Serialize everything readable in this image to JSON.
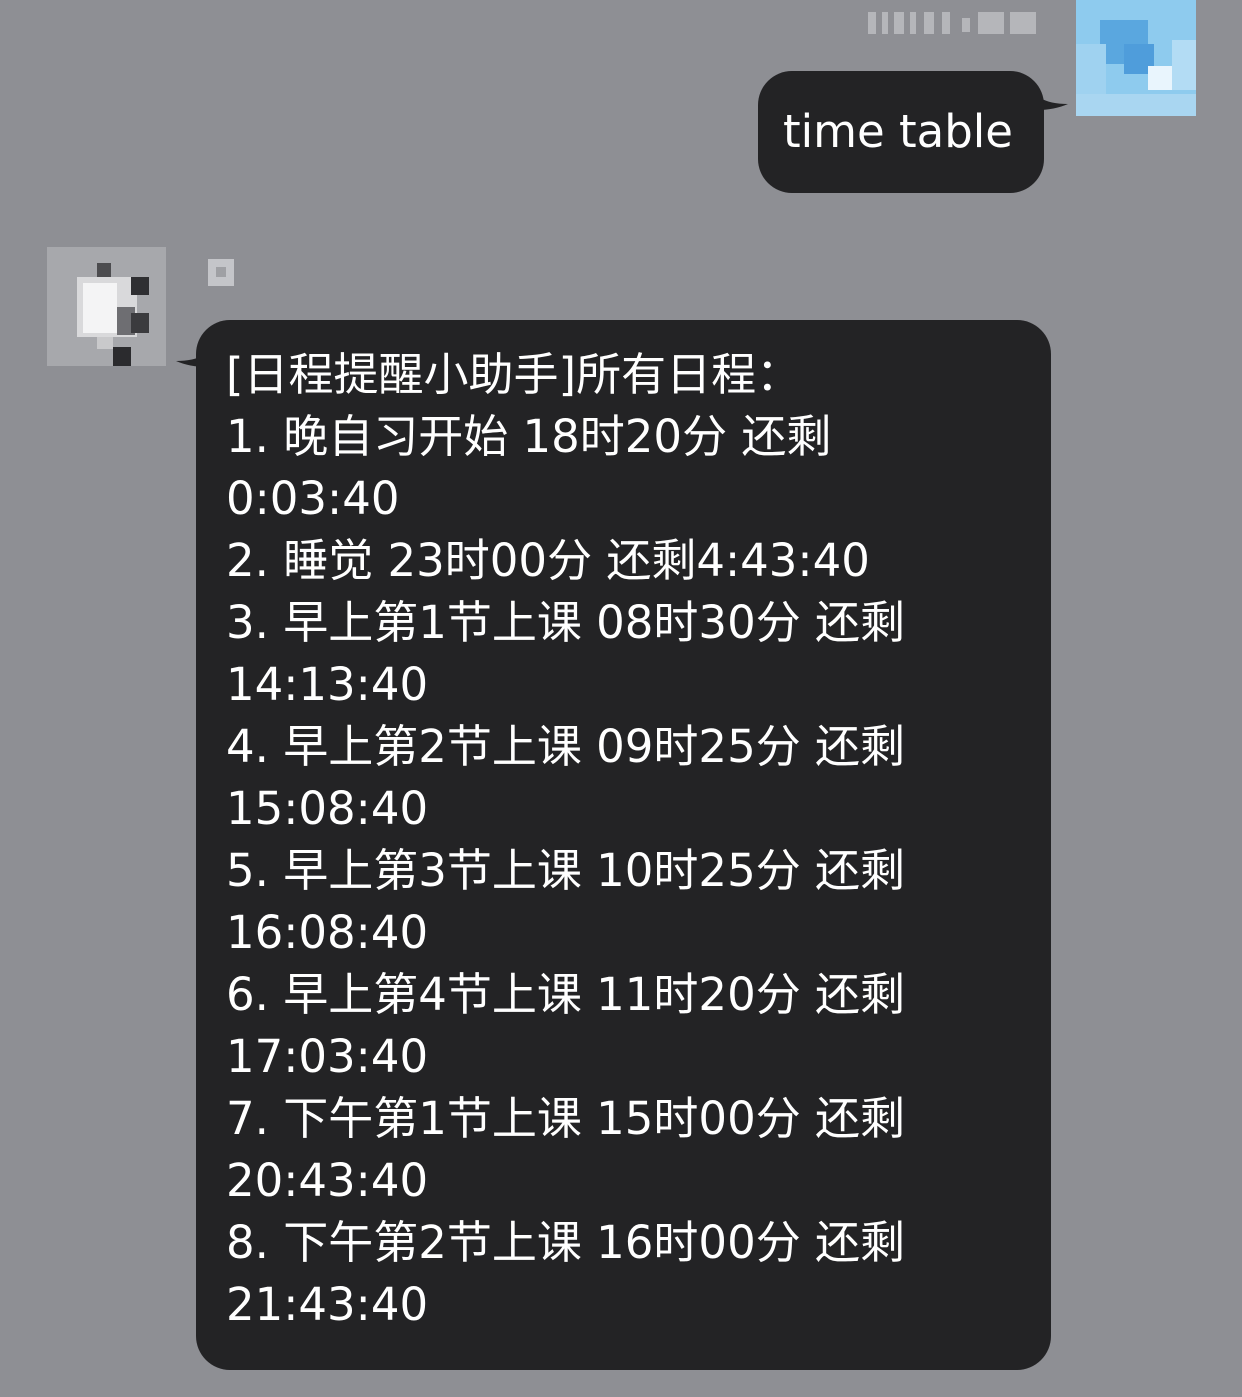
{
  "chat": {
    "outgoing": {
      "text": "time table"
    },
    "incoming": {
      "lines": [
        "[日程提醒小助手]所有日程：",
        "1. 晚自习开始 18时20分 还剩",
        "0:03:40",
        "2. 睡觉 23时00分 还剩4:43:40",
        "3. 早上第1节上课 08时30分 还剩",
        "14:13:40",
        "4. 早上第2节上课 09时25分 还剩",
        "15:08:40",
        "5. 早上第3节上课 10时25分 还剩",
        "16:08:40",
        "6. 早上第4节上课 11时20分 还剩",
        "17:03:40",
        "7. 下午第1节上课 15时00分 还剩",
        "20:43:40",
        "8. 下午第2节上课 16时00分 还剩",
        "21:43:40"
      ]
    }
  },
  "colors": {
    "background": "#8e8f94",
    "bubble": "#232325",
    "text": "#ffffff",
    "avatar_right": "#7fbfe6"
  }
}
